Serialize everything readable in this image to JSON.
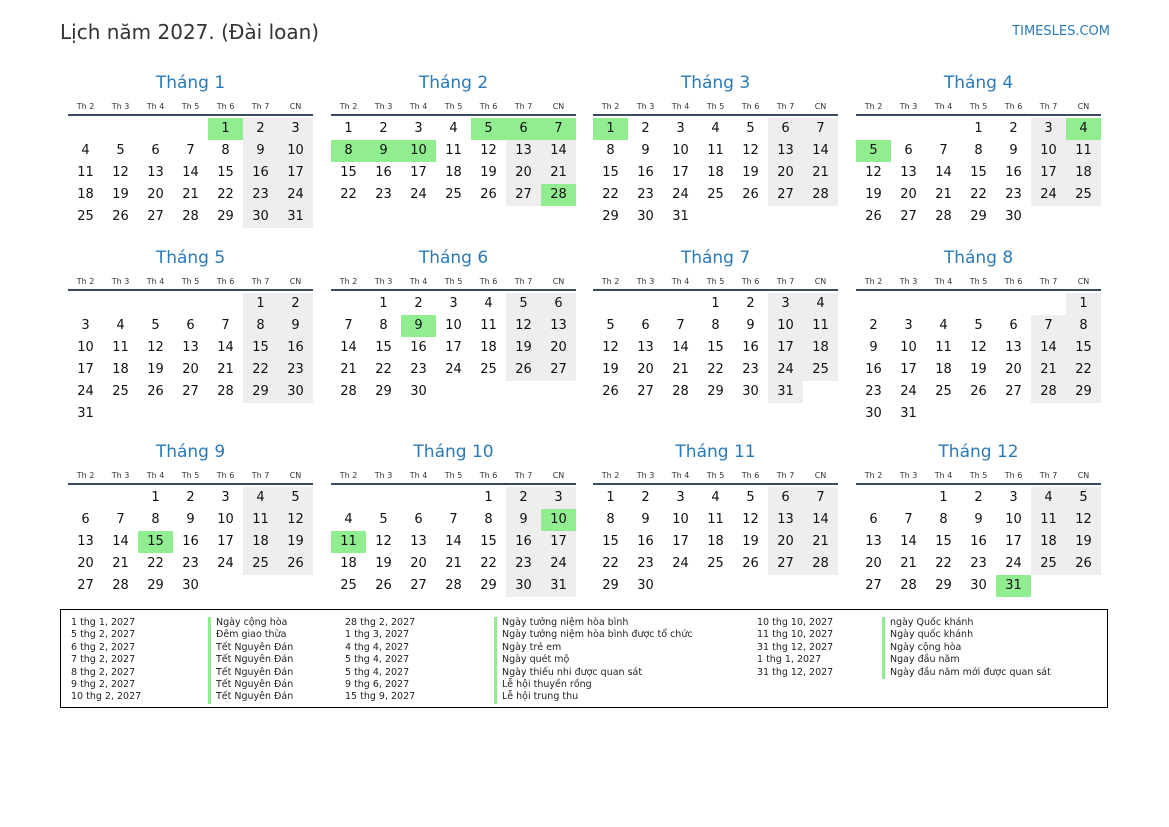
{
  "page": {
    "title": "Lịch năm 2027. (Đài loan)",
    "site": "TIMESLES.COM"
  },
  "weekdays": [
    "Th 2",
    "Th 3",
    "Th 4",
    "Th 5",
    "Th 6",
    "Th 7",
    "CN"
  ],
  "colors": {
    "title": "#2a7ab8",
    "holiday": "#90ee90",
    "weekend": "#eeeeee",
    "rule": "#3b4a63"
  },
  "months": [
    {
      "name": "Tháng 1",
      "offset": 4,
      "days": 31,
      "holidays": [
        1
      ]
    },
    {
      "name": "Tháng 2",
      "offset": 0,
      "days": 28,
      "holidays": [
        5,
        6,
        7,
        8,
        9,
        10,
        28
      ]
    },
    {
      "name": "Tháng 3",
      "offset": 0,
      "days": 31,
      "holidays": [
        1
      ]
    },
    {
      "name": "Tháng 4",
      "offset": 3,
      "days": 30,
      "holidays": [
        4,
        5
      ]
    },
    {
      "name": "Tháng 5",
      "offset": 5,
      "days": 31,
      "holidays": []
    },
    {
      "name": "Tháng 6",
      "offset": 1,
      "days": 30,
      "holidays": [
        9
      ]
    },
    {
      "name": "Tháng 7",
      "offset": 3,
      "days": 31,
      "holidays": []
    },
    {
      "name": "Tháng 8",
      "offset": 6,
      "days": 31,
      "holidays": []
    },
    {
      "name": "Tháng 9",
      "offset": 2,
      "days": 30,
      "holidays": [
        15
      ]
    },
    {
      "name": "Tháng 10",
      "offset": 4,
      "days": 31,
      "holidays": [
        10,
        11
      ]
    },
    {
      "name": "Tháng 11",
      "offset": 0,
      "days": 30,
      "holidays": []
    },
    {
      "name": "Tháng 12",
      "offset": 2,
      "days": 31,
      "holidays": [
        31
      ]
    }
  ],
  "legend": [
    [
      {
        "date": "1 thg 1, 2027",
        "name": "Ngày cộng hòa"
      },
      {
        "date": "5 thg 2, 2027",
        "name": "Đêm giao thừa"
      },
      {
        "date": "6 thg 2, 2027",
        "name": "Tết Nguyên Đán"
      },
      {
        "date": "7 thg 2, 2027",
        "name": "Tết Nguyên Đán"
      },
      {
        "date": "8 thg 2, 2027",
        "name": "Tết Nguyên Đán"
      },
      {
        "date": "9 thg 2, 2027",
        "name": "Tết Nguyên Đán"
      },
      {
        "date": "10 thg 2, 2027",
        "name": "Tết Nguyên Đán"
      }
    ],
    [
      {
        "date": "28 thg 2, 2027",
        "name": "Ngày tưởng niệm hòa bình"
      },
      {
        "date": "1 thg 3, 2027",
        "name": "Ngày tưởng niệm hòa bình được tổ chức"
      },
      {
        "date": "4 thg 4, 2027",
        "name": "Ngày trẻ em"
      },
      {
        "date": "5 thg 4, 2027",
        "name": "Ngày quét mộ"
      },
      {
        "date": "5 thg 4, 2027",
        "name": "Ngày thiếu nhi được quan sát"
      },
      {
        "date": "9 thg 6, 2027",
        "name": "Lễ hội thuyền rồng"
      },
      {
        "date": "15 thg 9, 2027",
        "name": "Lễ hội trung thu"
      }
    ],
    [
      {
        "date": "10 thg 10, 2027",
        "name": "ngày Quốc khánh"
      },
      {
        "date": "11 thg 10, 2027",
        "name": "Ngày quốc khánh"
      },
      {
        "date": "31 thg 12, 2027",
        "name": "Ngày cộng hòa"
      },
      {
        "date": "1 thg 1, 2027",
        "name": "Ngay đầu năm"
      },
      {
        "date": "31 thg 12, 2027",
        "name": "Ngày đầu năm mới được quan sát"
      }
    ]
  ]
}
